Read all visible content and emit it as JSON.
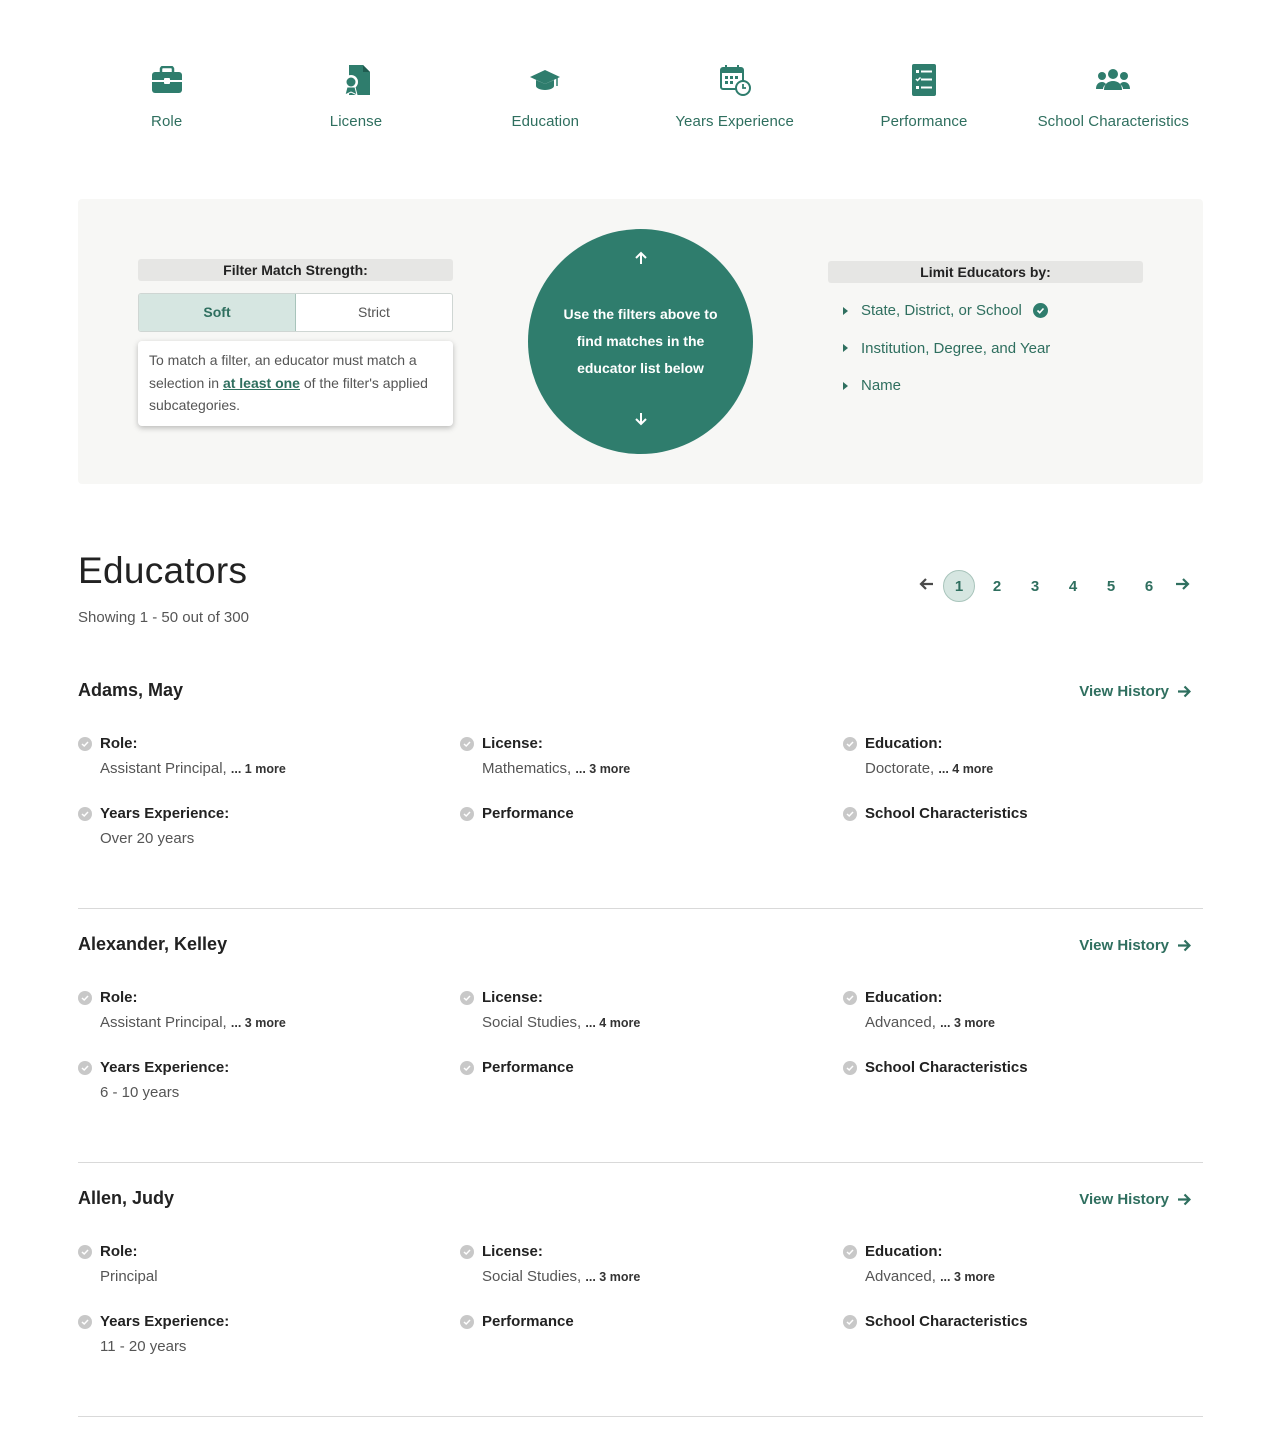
{
  "accent": "#2f7d6d",
  "categories": [
    {
      "label": "Role",
      "icon": "briefcase-icon"
    },
    {
      "label": "License",
      "icon": "license-icon"
    },
    {
      "label": "Education",
      "icon": "graduation-cap-icon"
    },
    {
      "label": "Years Experience",
      "icon": "calendar-clock-icon"
    },
    {
      "label": "Performance",
      "icon": "checklist-icon"
    },
    {
      "label": "School Characteristics",
      "icon": "users-icon"
    }
  ],
  "filter": {
    "strength_heading": "Filter Match Strength:",
    "soft_label": "Soft",
    "strict_label": "Strict",
    "selected": "Soft",
    "tooltip_prefix": "To match a filter, an educator must match a selection in ",
    "tooltip_link": "at least one",
    "tooltip_suffix": " of the filter's applied subcategories.",
    "circle_text": "Use the filters above to find matches in the educator list below",
    "limit_heading": "Limit Educators by:",
    "limit_items": [
      {
        "label": "State, District, or School",
        "checked": true
      },
      {
        "label": "Institution, Degree, and Year",
        "checked": false
      },
      {
        "label": "Name",
        "checked": false
      }
    ]
  },
  "educators_section": {
    "title": "Educators",
    "count_text": "Showing 1 - 50 out of 300",
    "pages": [
      "1",
      "2",
      "3",
      "4",
      "5",
      "6"
    ],
    "current_page": "1"
  },
  "educators": [
    {
      "name": "Adams, May",
      "view_history": "View History",
      "role_label": "Role:",
      "role_value": "Assistant Principal, ",
      "role_more": "... 1 more",
      "license_label": "License:",
      "license_value": "Mathematics, ",
      "license_more": "... 3 more",
      "education_label": "Education:",
      "education_value": "Doctorate, ",
      "education_more": "... 4 more",
      "years_label": "Years Experience:",
      "years_value": "Over 20 years",
      "performance_label": "Performance",
      "school_label": "School Characteristics"
    },
    {
      "name": "Alexander, Kelley",
      "view_history": "View History",
      "role_label": "Role:",
      "role_value": "Assistant Principal, ",
      "role_more": "... 3 more",
      "license_label": "License:",
      "license_value": "Social Studies, ",
      "license_more": "... 4 more",
      "education_label": "Education:",
      "education_value": "Advanced, ",
      "education_more": "... 3 more",
      "years_label": "Years Experience:",
      "years_value": "6 - 10 years",
      "performance_label": "Performance",
      "school_label": "School Characteristics"
    },
    {
      "name": "Allen, Judy",
      "view_history": "View History",
      "role_label": "Role:",
      "role_value": "Principal",
      "role_more": "",
      "license_label": "License:",
      "license_value": "Social Studies, ",
      "license_more": "... 3 more",
      "education_label": "Education:",
      "education_value": "Advanced, ",
      "education_more": "... 3 more",
      "years_label": "Years Experience:",
      "years_value": "11 - 20 years",
      "performance_label": "Performance",
      "school_label": "School Characteristics"
    }
  ]
}
